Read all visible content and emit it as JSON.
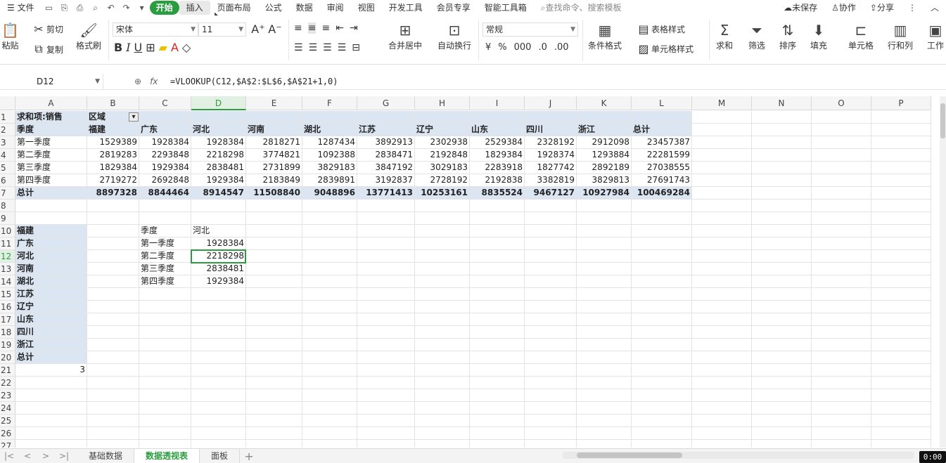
{
  "menubar": {
    "file": "文件",
    "tabs": [
      "开始",
      "插入",
      "页面布局",
      "公式",
      "数据",
      "审阅",
      "视图",
      "开发工具",
      "会员专享",
      "智能工具箱"
    ],
    "search_placeholder": "查找命令、搜索模板",
    "unsaved": "未保存",
    "collab": "协作",
    "share": "分享"
  },
  "ribbon": {
    "paste": "粘贴",
    "cut": "剪切",
    "copy": "复制",
    "format_painter": "格式刷",
    "font_name": "宋体",
    "font_size": "11",
    "merge_center": "合并居中",
    "wrap": "自动换行",
    "number_format": "常规",
    "conditional_format": "条件格式",
    "table_style": "表格样式",
    "cell_style": "单元格样式",
    "sum": "求和",
    "filter": "筛选",
    "sort": "排序",
    "fill": "填充",
    "cell": "单元格",
    "rowcol": "行和列",
    "worksheet": "工作"
  },
  "formula_bar": {
    "name_box": "D12",
    "fx": "fx",
    "formula": "=VLOOKUP(C12,$A$2:$L$6,$A$21+1,0)"
  },
  "columns": [
    "A",
    "B",
    "C",
    "D",
    "E",
    "F",
    "G",
    "H",
    "I",
    "J",
    "K",
    "L",
    "M",
    "N",
    "O",
    "P"
  ],
  "rows": [
    "1",
    "2",
    "3",
    "4",
    "5",
    "6",
    "7",
    "8",
    "9",
    "10",
    "11",
    "12",
    "13",
    "14",
    "15",
    "16",
    "17",
    "18",
    "19",
    "20",
    "21",
    "22",
    "23",
    "24",
    "25",
    "26",
    "27"
  ],
  "pivot": {
    "sum_label": "求和项:销售",
    "region_label": "区域",
    "season_label": "季度",
    "headers": [
      "福建",
      "广东",
      "河北",
      "河南",
      "湖北",
      "江苏",
      "辽宁",
      "山东",
      "四川",
      "浙江",
      "总计"
    ],
    "data": [
      {
        "label": "第一季度",
        "values": [
          "1529389",
          "1928384",
          "1928384",
          "2818271",
          "1287434",
          "3892913",
          "2302938",
          "2529384",
          "2328192",
          "2912098",
          "23457387"
        ]
      },
      {
        "label": "第二季度",
        "values": [
          "2819283",
          "2293848",
          "2218298",
          "3774821",
          "1092388",
          "2838471",
          "2192848",
          "1829384",
          "1928374",
          "1293884",
          "22281599"
        ]
      },
      {
        "label": "第三季度",
        "values": [
          "1829384",
          "1929384",
          "2838481",
          "2731899",
          "3829183",
          "3847192",
          "3029183",
          "2283918",
          "1827742",
          "2892189",
          "27038555"
        ]
      },
      {
        "label": "第四季度",
        "values": [
          "2719272",
          "2692848",
          "1929384",
          "2183849",
          "2839891",
          "3192837",
          "2728192",
          "2192838",
          "3382819",
          "3829813",
          "27691743"
        ]
      }
    ],
    "total": {
      "label": "总计",
      "values": [
        "8897328",
        "8844464",
        "8914547",
        "11508840",
        "9048896",
        "13771413",
        "10253161",
        "8835524",
        "9467127",
        "10927984",
        "100469284"
      ]
    }
  },
  "list": [
    "福建",
    "广东",
    "河北",
    "河南",
    "湖北",
    "江苏",
    "辽宁",
    "山东",
    "四川",
    "浙江",
    "总计"
  ],
  "a21": "3",
  "lookup": {
    "header_season": "季度",
    "header_region": "河北",
    "rows": [
      {
        "season": "第一季度",
        "value": "1928384"
      },
      {
        "season": "第二季度",
        "value": "2218298"
      },
      {
        "season": "第三季度",
        "value": "2838481"
      },
      {
        "season": "第四季度",
        "value": "1929384"
      }
    ]
  },
  "sheets": [
    "基础数据",
    "数据透视表",
    "面板"
  ],
  "active_sheet": 1,
  "timer": "0:00"
}
